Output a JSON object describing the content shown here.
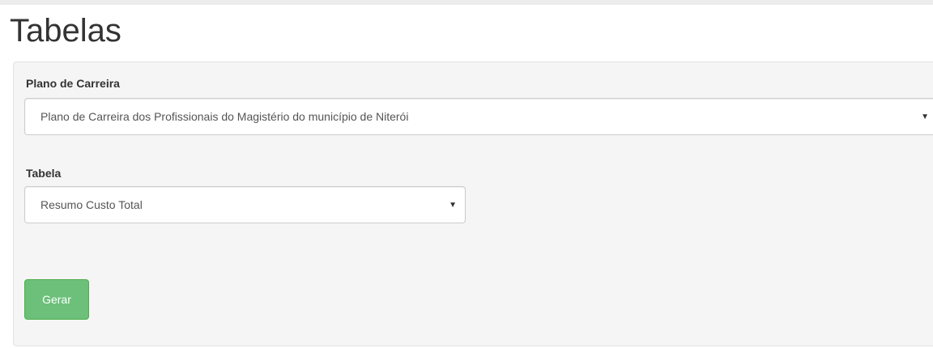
{
  "page": {
    "title": "Tabelas"
  },
  "form": {
    "plano": {
      "label": "Plano de Carreira",
      "selected": "Plano de Carreira dos Profissionais do Magistério do município de Niterói",
      "arrow_icon": "caret-down-icon"
    },
    "tabela": {
      "label": "Tabela",
      "selected": "Resumo Custo Total",
      "arrow_icon": "caret-down-icon"
    },
    "submit_label": "Gerar"
  },
  "colors": {
    "panel_background": "#f5f5f5",
    "button_green": "#6cc07a",
    "button_border": "#4cae4c"
  }
}
